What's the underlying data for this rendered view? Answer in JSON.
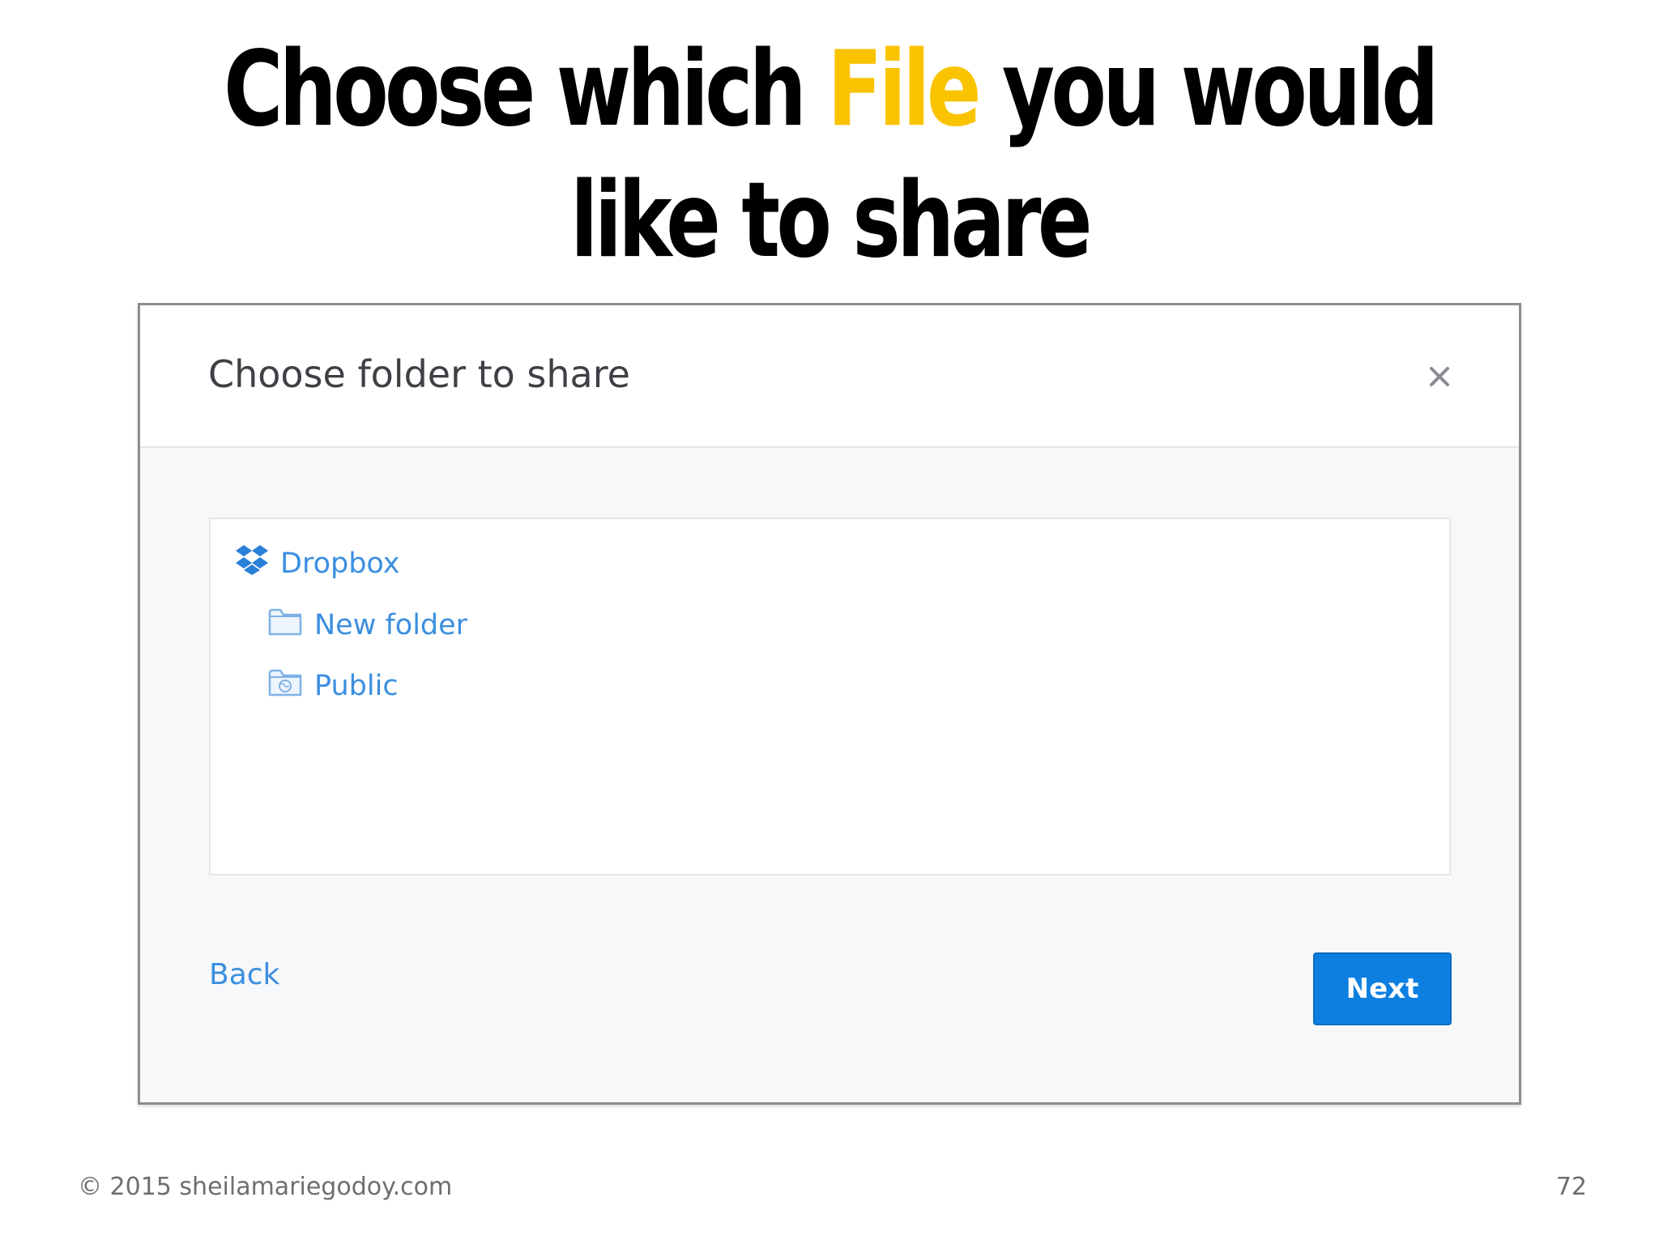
{
  "slide": {
    "title_part1": "Choose which ",
    "title_highlight": "File",
    "title_part2": " you would like to share",
    "highlight_color": "#f9c300",
    "copyright": "© 2015 sheilamariegodoy.com",
    "page_number": "72"
  },
  "dialog": {
    "title": "Choose folder to share",
    "close_icon": "close-icon",
    "tree": {
      "root": {
        "label": "Dropbox",
        "icon": "dropbox-logo-icon"
      },
      "children": [
        {
          "label": "New folder",
          "icon": "folder-icon"
        },
        {
          "label": "Public",
          "icon": "public-folder-icon"
        }
      ]
    },
    "back_label": "Back",
    "next_label": "Next",
    "accent_color": "#0d7fe0",
    "link_color": "#3b8fe0"
  }
}
